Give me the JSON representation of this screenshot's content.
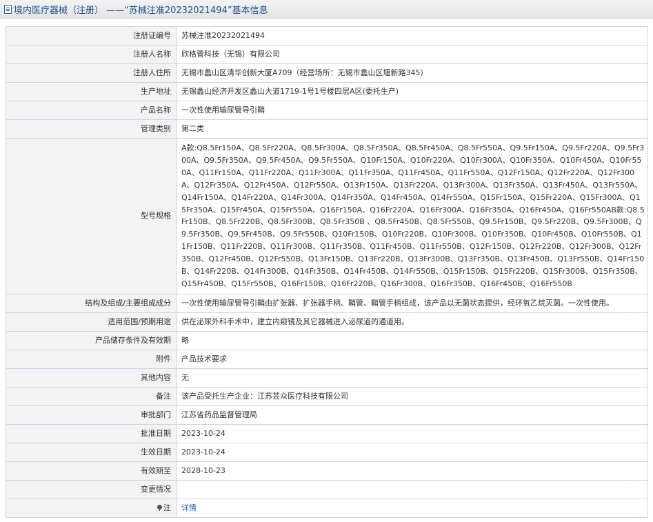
{
  "header": {
    "title": "境内医疗器械（注册） ——“苏械注准20232021494”基本信息"
  },
  "rows": [
    {
      "label": "注册证编号",
      "value": "苏械注准20232021494"
    },
    {
      "label": "注册人名称",
      "value": "欣格菅科技（无锡）有限公司"
    },
    {
      "label": "注册人住所",
      "value": "无锡市蠡山区清华创新大厦A709（经营场所：无锡市蠡山区堰新路345）"
    },
    {
      "label": "生产地址",
      "value": "无锡蠡山经济开发区蠡山大道1719-1号1号楼四层A区(委托生产)"
    },
    {
      "label": "产品名称",
      "value": "一次性使用输尿管导引鞘"
    },
    {
      "label": "管理类别",
      "value": "第二类"
    },
    {
      "label": "型号规格",
      "value": "A款:Q8.5Fr150A、Q8.5Fr220A、Q8.5Fr300A、Q8.5Fr350A、Q8.5Fr450A、Q8.5Fr550A、Q9.5Fr150A、Q9.5Fr220A、Q9.5Fr300A、Q9.5Fr350A、Q9.5Fr450A、Q9.5Fr550A、Q10Fr150A、Q10Fr220A、Q10Fr300A、Q10Fr350A、Q10Fr450A、Q10Fr550A、Q11Fr150A、Q11Fr220A、Q11Fr300A、Q11Fr350A、Q11Fr450A、Q11Fr550A、Q12Fr150A、Q12Fr220A、Q12Fr300A、Q12Fr350A、Q12Fr450A、Q12Fr550A、Q13Fr150A、Q13Fr220A、Q13Fr300A、Q13Fr350A、Q13Fr450A、Q13Fr550A、Q14Fr150A、Q14Fr220A、Q14Fr300A、Q14Fr350A、Q14Fr450A、Q14Fr550A、Q15Fr150A、Q15Fr220A、Q15Fr300A、Q15Fr350A、Q15Fr450A、Q15Fr550A、Q16Fr150A、Q16Fr220A、Q16Fr300A、Q16Fr350A、Q16Fr450A、Q16Fr550AB款:Q8.5Fr150B、Q8.5Fr220B、Q8.5Fr300B、Q8.5Fr350B 、Q8.5Fr450B、Q8.5Fr550B、Q9.5Fr150B、Q9.5Fr220B、Q9.5Fr300B、Q9.5Fr350B、Q9.5Fr450B、Q9.5Fr550B、Q10Fr150B、Q10Fr220B、Q10Fr300B、Q10Fr350B、Q10Fr450B、Q10Fr550B、Q11Fr150B、Q11Fr220B、Q11Fr300B、Q11Fr350B、Q11Fr450B、Q11Fr550B、Q12Fr150B、Q12Fr220B、Q12Fr300B、Q12Fr350B、Q12Fr450B、Q12Fr550B、Q13Fr150B、Q13Fr220B、Q13Fr300B、Q13Fr350B、Q13Fr450B、Q13Fr550B、Q14Fr150B、Q14Fr220B、Q14Fr300B、Q14Fr350B、Q14Fr450B、Q14Fr550B、Q15Fr150B、Q15Fr220B、Q15Fr300B、Q15Fr350B、Q15Fr450B、Q15Fr550B、Q16Fr150B、Q16Fr220B、Q16Fr300B、Q16Fr350B、Q16Fr450B、Q16Fr550B"
    },
    {
      "label": "结构及组成/主要组成成分",
      "value": "一次性使用输尿管导引鞘由扩张器、扩张器手柄、鞘管、鞘管手柄组成，该产品以无菌状态提供，经环氧乙烷灭菌。一次性使用。"
    },
    {
      "label": "适用范围/预期用途",
      "value": "供在泌尿外科手术中，建立内窥镜及其它器械进入泌尿道的通道用。"
    },
    {
      "label": "产品储存条件及有效期",
      "value": "略"
    },
    {
      "label": "附件",
      "value": "产品技术要求"
    },
    {
      "label": "其他内容",
      "value": "无"
    },
    {
      "label": "备注",
      "value": "该产品受托生产企业：江苏芸众医疗科技有限公司"
    },
    {
      "label": "审批部门",
      "value": "江苏省药品监督管理局"
    },
    {
      "label": "批准日期",
      "value": "2023-10-24"
    },
    {
      "label": "生效日期",
      "value": "2023-10-24"
    },
    {
      "label": "有效期至",
      "value": "2028-10-23"
    },
    {
      "label": "变更情况",
      "value": ""
    }
  ],
  "note": {
    "label": "注",
    "link": "详情"
  }
}
